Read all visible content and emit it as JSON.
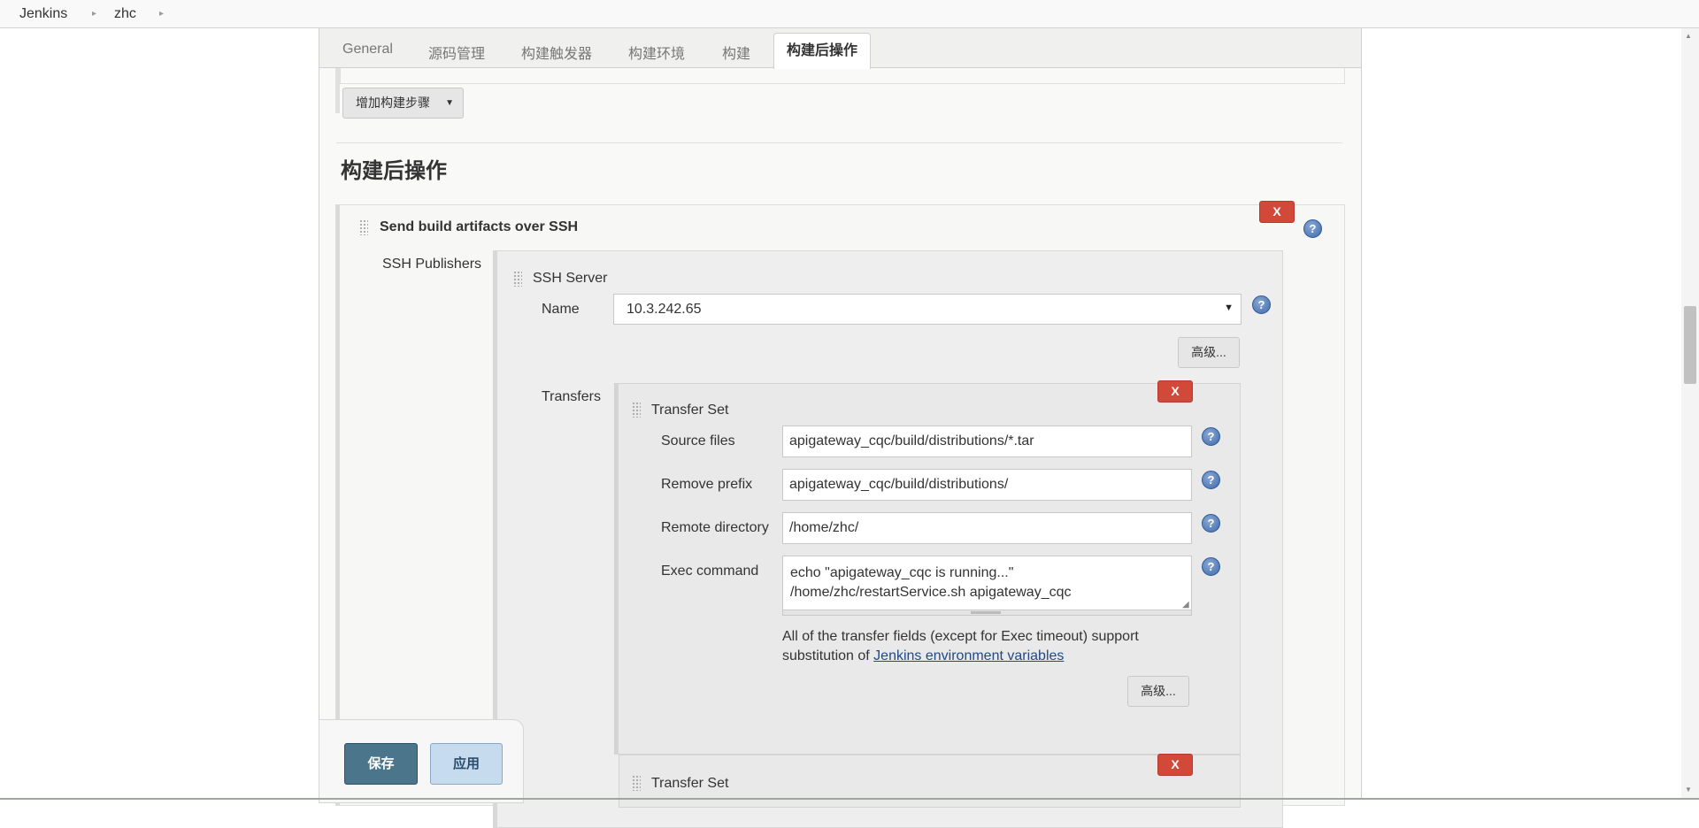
{
  "breadcrumb": {
    "items": [
      "Jenkins",
      "zhc"
    ],
    "separator": "▸"
  },
  "tabs": [
    "General",
    "源码管理",
    "构建触发器",
    "构建环境",
    "构建",
    "构建后操作"
  ],
  "active_tab": "构建后操作",
  "build": {
    "add_step_label": "增加构建步骤"
  },
  "post_build": {
    "section_title": "构建后操作",
    "ssh": {
      "title": "Send build artifacts over SSH",
      "publishers_label": "SSH Publishers",
      "server": {
        "title": "SSH Server",
        "name_label": "Name",
        "name_value": "10.3.242.65",
        "advanced_label": "高级...",
        "transfers_label": "Transfers"
      },
      "transfer_set": {
        "title": "Transfer Set",
        "source_files_label": "Source files",
        "source_files_value": "apigateway_cqc/build/distributions/*.tar",
        "remove_prefix_label": "Remove prefix",
        "remove_prefix_value": "apigateway_cqc/build/distributions/",
        "remote_directory_label": "Remote directory",
        "remote_directory_value": "/home/zhc/",
        "exec_command_label": "Exec command",
        "exec_command_lines": [
          "echo \"apigateway_cqc is running...\"",
          "/home/zhc/restartService.sh apigateway_cqc"
        ],
        "help_text_prefix": "All of the transfer fields (except for Exec timeout) support substitution of ",
        "help_link": "Jenkins environment variables",
        "advanced_label": "高级..."
      },
      "transfer_set_2": {
        "title": "Transfer Set"
      }
    }
  },
  "delete_label": "X",
  "help_label": "?",
  "actions": {
    "save_label": "保存",
    "apply_label": "应用"
  },
  "colors": {
    "danger": "#d24939",
    "save": "#4b758b",
    "apply": "#c7dbee",
    "link": "#204a87",
    "help": "#3f6aa8"
  }
}
